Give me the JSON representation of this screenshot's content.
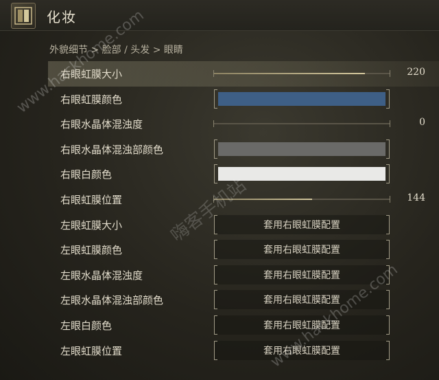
{
  "header": {
    "title": "化妆",
    "icon": "mirror-icon"
  },
  "breadcrumb": "外貌细节 > 脸部 / 头发 > 眼睛",
  "colors": {
    "iris_color": "#3e5f86",
    "lens_opacity_color": "#6a6a68",
    "sclera_color": "#e9e9e7",
    "slider_fill": "#c8bc92"
  },
  "rows": [
    {
      "label": "右眼虹膜大小",
      "type": "slider",
      "value": "220",
      "fill_fraction": 0.86,
      "selected": true
    },
    {
      "label": "右眼虹膜颜色",
      "type": "color",
      "color": "#3e5f86"
    },
    {
      "label": "右眼水晶体混浊度",
      "type": "slider",
      "value": "0",
      "fill_fraction": 0.0
    },
    {
      "label": "右眼水晶体混浊部颜色",
      "type": "color",
      "color": "#6a6a68"
    },
    {
      "label": "右眼白颜色",
      "type": "color",
      "color": "#e9e9e7"
    },
    {
      "label": "右眼虹膜位置",
      "type": "slider",
      "value": "144",
      "fill_fraction": 0.56
    },
    {
      "label": "左眼虹膜大小",
      "type": "button",
      "button_label": "套用右眼虹膜配置"
    },
    {
      "label": "左眼虹膜颜色",
      "type": "button",
      "button_label": "套用右眼虹膜配置"
    },
    {
      "label": "左眼水晶体混浊度",
      "type": "button",
      "button_label": "套用右眼虹膜配置"
    },
    {
      "label": "左眼水晶体混浊部颜色",
      "type": "button",
      "button_label": "套用右眼虹膜配置"
    },
    {
      "label": "左眼白颜色",
      "type": "button",
      "button_label": "套用右眼虹膜配置"
    },
    {
      "label": "左眼虹膜位置",
      "type": "button",
      "button_label": "套用右眼虹膜配置"
    }
  ],
  "watermarks": {
    "site_cn": "嗨客手机站",
    "url": "www.hackhome.com"
  }
}
